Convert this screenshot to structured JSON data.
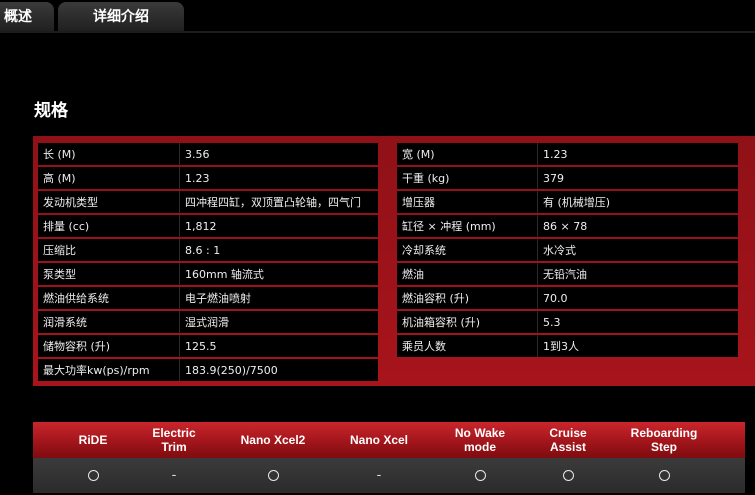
{
  "tabs": [
    {
      "label": "概述"
    },
    {
      "label": "详细介绍"
    }
  ],
  "section_title": "规格",
  "specs": {
    "left": [
      {
        "label": "长 (M)",
        "value": "3.56"
      },
      {
        "label": "高 (M)",
        "value": "1.23"
      },
      {
        "label": "发动机类型",
        "value": "四冲程四缸，双顶置凸轮轴，四气门"
      },
      {
        "label": "排量 (cc)",
        "value": "1,812"
      },
      {
        "label": "压缩比",
        "value": "8.6 : 1"
      },
      {
        "label": "泵类型",
        "value": "160mm 轴流式"
      },
      {
        "label": "燃油供给系统",
        "value": "电子燃油喷射"
      },
      {
        "label": "润滑系统",
        "value": "湿式润滑"
      },
      {
        "label": "储物容积 (升)",
        "value": "125.5"
      },
      {
        "label": "最大功率kw(ps)/rpm",
        "value": "183.9(250)/7500"
      }
    ],
    "right": [
      {
        "label": "宽 (M)",
        "value": "1.23"
      },
      {
        "label": "干重 (kg)",
        "value": "379"
      },
      {
        "label": "增压器",
        "value": "有 (机械增压)"
      },
      {
        "label": "缸径 × 冲程 (mm)",
        "value": "86 × 78"
      },
      {
        "label": "冷却系统",
        "value": "水冷式"
      },
      {
        "label": "燃油",
        "value": "无铅汽油"
      },
      {
        "label": "燃油容积 (升)",
        "value": "70.0"
      },
      {
        "label": "机油箱容积 (升)",
        "value": "5.3"
      },
      {
        "label": "乘员人数",
        "value": "1到3人"
      }
    ]
  },
  "features": [
    {
      "name": "RiDE",
      "value": "circle"
    },
    {
      "name": "Electric\nTrim",
      "value": "-"
    },
    {
      "name": "Nano Xcel2",
      "value": "circle"
    },
    {
      "name": "Nano Xcel",
      "value": "-"
    },
    {
      "name": "No Wake\nmode",
      "value": "circle"
    },
    {
      "name": "Cruise\nAssist",
      "value": "circle"
    },
    {
      "name": "Reboarding\nStep",
      "value": "circle"
    }
  ],
  "colors": {
    "panel_red": "#a8141b",
    "header_red": "#c9262c",
    "background": "#000000"
  }
}
